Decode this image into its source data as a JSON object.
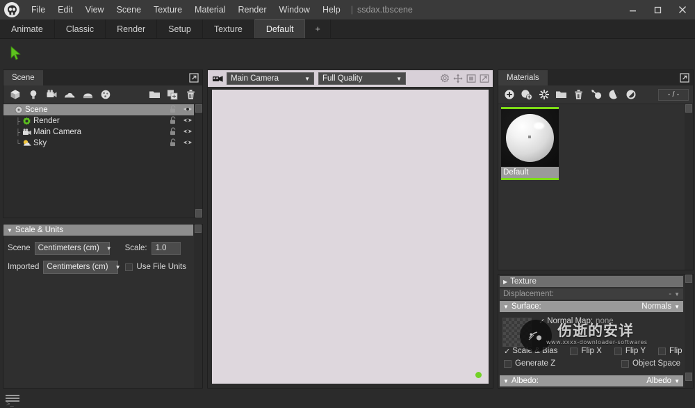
{
  "app": {
    "logo_icon": "skull-logo-icon",
    "document_title": "ssdax.tbscene",
    "separator": "|"
  },
  "menubar": {
    "items": [
      {
        "label": "File"
      },
      {
        "label": "Edit"
      },
      {
        "label": "View"
      },
      {
        "label": "Scene"
      },
      {
        "label": "Texture"
      },
      {
        "label": "Material"
      },
      {
        "label": "Render"
      },
      {
        "label": "Window"
      },
      {
        "label": "Help"
      }
    ]
  },
  "window_controls": {
    "minimize": "minimize-icon",
    "maximize": "maximize-icon",
    "close": "close-icon"
  },
  "layout_tabs": {
    "items": [
      {
        "label": "Animate",
        "active": false
      },
      {
        "label": "Classic",
        "active": false
      },
      {
        "label": "Render",
        "active": false
      },
      {
        "label": "Setup",
        "active": false
      },
      {
        "label": "Texture",
        "active": false
      },
      {
        "label": "Default",
        "active": true
      }
    ],
    "add_label": "+"
  },
  "toolbar": {
    "select_tool_icon": "cursor-arrow-icon",
    "select_tool_color": "#5dc21e"
  },
  "scene_panel": {
    "tab_label": "Scene",
    "expand_icon": "popout-icon",
    "toolbar_icons": [
      "add-mesh-icon",
      "add-light-icon",
      "add-camera-icon",
      "add-sky-icon",
      "add-fog-icon",
      "add-turntable-icon"
    ],
    "toolbar_right_icons": [
      "folder-icon",
      "duplicate-icon",
      "trash-icon"
    ],
    "tree": [
      {
        "label": "Scene",
        "icon": "scene-root-icon",
        "depth": 0,
        "selected": true,
        "lock": "unlocked-icon",
        "visibility": "eye-icon"
      },
      {
        "label": "Render",
        "icon": "render-gear-icon",
        "depth": 1,
        "selected": false,
        "lock": "unlocked-icon",
        "visibility": "eye-icon"
      },
      {
        "label": "Main Camera",
        "icon": "camera-icon",
        "depth": 1,
        "selected": false,
        "lock": "unlocked-icon",
        "visibility": "eye-icon"
      },
      {
        "label": "Sky",
        "icon": "sky-sun-icon",
        "depth": 1,
        "selected": false,
        "lock": "unlocked-icon",
        "visibility": "eye-icon"
      }
    ]
  },
  "scale_units": {
    "header": "Scale & Units",
    "collapse_arrow": "▼",
    "scene_label": "Scene",
    "scene_units": "Centimeters (cm)",
    "scale_label": "Scale:",
    "scale_value": "1.0",
    "imported_label": "Imported",
    "imported_units": "Centimeters (cm)",
    "use_file_units_label": "Use File Units",
    "use_file_units_checked": false
  },
  "viewport": {
    "camera_icon": "camera-icon",
    "camera_value": "Main Camera",
    "quality_value": "Full Quality",
    "header_icons": [
      "settings-gear-icon",
      "move-gizmo-icon",
      "frame-icon",
      "fullscreen-icon"
    ],
    "status_dot_color": "#72d126",
    "background_color": "#ded7dd"
  },
  "materials_panel": {
    "tab_label": "Materials",
    "expand_icon": "popout-icon",
    "toolbar_icons": [
      "add-material-icon",
      "duplicate-material-icon",
      "clear-material-icon",
      "folder-icon",
      "trash-icon",
      "assign-material-icon",
      "pick-material-icon",
      "refresh-material-icon"
    ],
    "count_value": "- / -",
    "items": [
      {
        "name": "Default",
        "selected": true,
        "thumbnail": "sphere-preview-icon"
      }
    ]
  },
  "properties": {
    "texture_section": {
      "label": "Texture",
      "arrow": "▶"
    },
    "displacement_row": {
      "label": "Displacement:",
      "value": "-",
      "arrow": "▼"
    },
    "surface_section": {
      "label": "Surface:",
      "arrow": "▼",
      "value": "Normals"
    },
    "normal_map": {
      "label": "Normal Map:",
      "value": "none",
      "checked": true
    },
    "checkboxes": [
      {
        "label": "Scale & Bias",
        "checked": true
      },
      {
        "label": "Flip X",
        "checked": false
      },
      {
        "label": "Flip Y",
        "checked": false
      },
      {
        "label": "Flip Z",
        "checked": false
      },
      {
        "label": "Generate Z",
        "checked": false
      },
      {
        "label": "Object Space",
        "checked": false
      }
    ],
    "albedo_section": {
      "label": "Albedo:",
      "arrow": "▼",
      "value": "Albedo"
    }
  },
  "watermark": {
    "text": "伤逝的安详",
    "subtext": "www.xxxx-downloader-softwares",
    "logo_icon": "watermark-logo-icon"
  },
  "status_bar": {
    "log_icon": "console-lines-icon",
    "prompt": ">_"
  }
}
